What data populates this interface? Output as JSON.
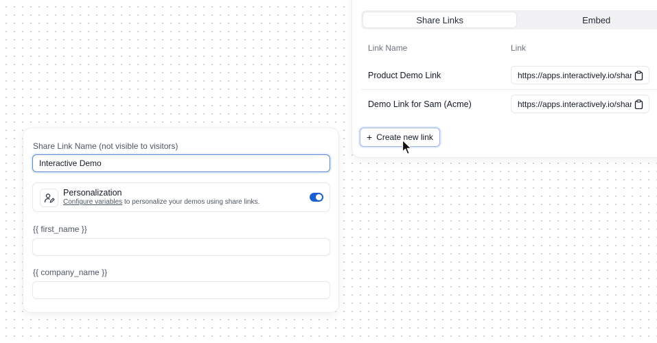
{
  "share_panel": {
    "tabs": [
      {
        "label": "Share Links",
        "active": true
      },
      {
        "label": "Embed",
        "active": false
      }
    ],
    "columns": {
      "name": "Link Name",
      "link": "Link"
    },
    "rows": [
      {
        "name": "Product Demo Link",
        "url": "https://apps.interactively.io/share"
      },
      {
        "name": "Demo Link for Sam (Acme)",
        "url": "https://apps.interactively.io/share"
      }
    ],
    "create_button": {
      "icon": "plus-icon",
      "label": "Create new link"
    }
  },
  "form": {
    "share_name_label": "Share Link Name (not visible to visitors)",
    "share_name_value": "Interactive Demo",
    "personalization": {
      "icon": "user-edit-icon",
      "title": "Personalization",
      "link_text": "Configure variables",
      "desc_rest": " to personalize your demos using share links.",
      "enabled": true
    },
    "variables": [
      {
        "label": "{{ first_name }}",
        "value": ""
      },
      {
        "label": "{{ company_name }}",
        "value": ""
      }
    ]
  },
  "colors": {
    "accent": "#1d5fd1",
    "focus_border": "#5b8bd4"
  }
}
